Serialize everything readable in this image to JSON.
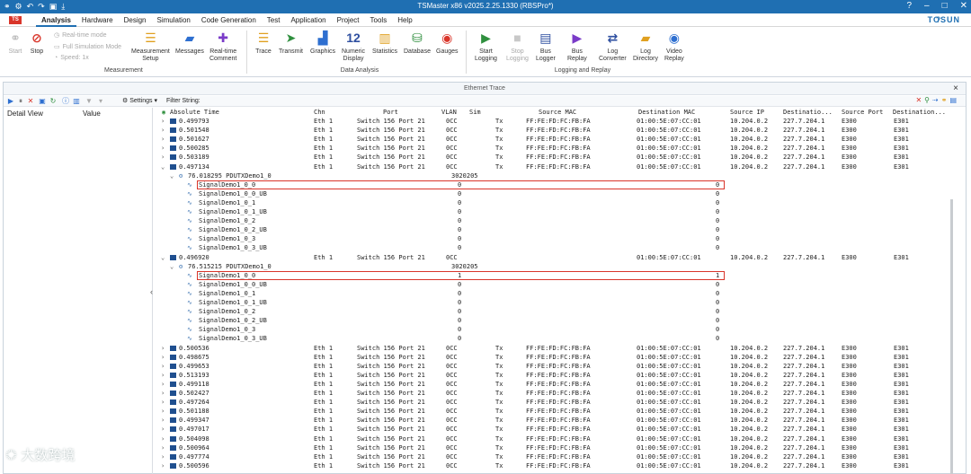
{
  "window": {
    "title": "TSMaster x86 v2025.2.25.1330 (RBSPro*)",
    "help": "?",
    "brand": "TOSUN"
  },
  "menus": [
    "Analysis",
    "Hardware",
    "Design",
    "Simulation",
    "Code Generation",
    "Test",
    "Application",
    "Project",
    "Tools",
    "Help"
  ],
  "ribbon": {
    "start": "Start",
    "stop": "Stop",
    "realtime": "Real-time mode",
    "fullsim": "Full Simulation Mode",
    "speed": "Speed: 1x",
    "measurement_setup": "Measurement\nSetup",
    "messages": "Messages",
    "realtime_comment": "Real-time\nComment",
    "group_measurement": "Measurement",
    "trace": "Trace",
    "transmit": "Transmit",
    "graphics": "Graphics",
    "numeric_display": "Numeric\nDisplay",
    "statistics": "Statistics",
    "database": "Database",
    "gauges": "Gauges",
    "group_data_analysis": "Data Analysis",
    "start_logging": "Start\nLogging",
    "stop_logging": "Stop\nLogging",
    "bus_logger": "Bus\nLogger",
    "bus_replay": "Bus\nReplay",
    "log_converter": "Log\nConverter",
    "log_directory": "Log\nDirectory",
    "video_replay": "Video\nReplay",
    "group_logging": "Logging and Replay",
    "numeric_glyph": "12"
  },
  "panel": {
    "title": "Ethernet Trace",
    "settings": "Settings",
    "filter": "Filter String:",
    "detail_view": "Detail View",
    "value": "Value"
  },
  "columns": [
    "Absolute Time",
    "Chn",
    "Port",
    "VLAN",
    "Sim",
    "Source MAC",
    "Destination MAC",
    "Source IP",
    "Destinatio...",
    "Source Port",
    "Destination..."
  ],
  "rows": [
    {
      "kind": "frame",
      "time": "0.499793",
      "chn": "Eth 1",
      "port": "Switch 156 Port 21",
      "vlan": "0CC",
      "dir": "Tx",
      "smac": "FF:FE:FD:FC:FB:FA",
      "dmac": "01:00:5E:07:CC:01",
      "sip": "10.204.0.2",
      "dip": "227.7.204.1",
      "sport": "E300",
      "dport": "E301"
    },
    {
      "kind": "frame",
      "time": "0.501548",
      "chn": "Eth 1",
      "port": "Switch 156 Port 21",
      "vlan": "0CC",
      "dir": "Tx",
      "smac": "FF:FE:FD:FC:FB:FA",
      "dmac": "01:00:5E:07:CC:01",
      "sip": "10.204.0.2",
      "dip": "227.7.204.1",
      "sport": "E300",
      "dport": "E301"
    },
    {
      "kind": "frame",
      "time": "0.501627",
      "chn": "Eth 1",
      "port": "Switch 156 Port 21",
      "vlan": "0CC",
      "dir": "Tx",
      "smac": "FF:FE:FD:FC:FB:FA",
      "dmac": "01:00:5E:07:CC:01",
      "sip": "10.204.0.2",
      "dip": "227.7.204.1",
      "sport": "E300",
      "dport": "E301"
    },
    {
      "kind": "frame",
      "time": "0.500285",
      "chn": "Eth 1",
      "port": "Switch 156 Port 21",
      "vlan": "0CC",
      "dir": "Tx",
      "smac": "FF:FE:FD:FC:FB:FA",
      "dmac": "01:00:5E:07:CC:01",
      "sip": "10.204.0.2",
      "dip": "227.7.204.1",
      "sport": "E300",
      "dport": "E301"
    },
    {
      "kind": "frame",
      "time": "0.503189",
      "chn": "Eth 1",
      "port": "Switch 156 Port 21",
      "vlan": "0CC",
      "dir": "Tx",
      "smac": "FF:FE:FD:FC:FB:FA",
      "dmac": "01:00:5E:07:CC:01",
      "sip": "10.204.0.2",
      "dip": "227.7.204.1",
      "sport": "E300",
      "dport": "E301"
    },
    {
      "kind": "frame",
      "expanded": true,
      "time": "0.497134",
      "chn": "Eth 1",
      "port": "Switch 156 Port 21",
      "vlan": "0CC",
      "dir": "Tx",
      "smac": "FF:FE:FD:FC:FB:FA",
      "dmac": "01:00:5E:07:CC:01",
      "sip": "10.204.0.2",
      "dip": "227.7.204.1",
      "sport": "E300",
      "dport": "E301"
    },
    {
      "kind": "pdu",
      "name": "76.018295 PDUTXDemo1_0",
      "value": "3020205"
    },
    {
      "kind": "signal",
      "name": "SignalDemo1_0_0",
      "raw": "0",
      "phys": "0",
      "highlight": true
    },
    {
      "kind": "signal",
      "name": "SignalDemo1_0_0_UB",
      "raw": "0",
      "phys": "0"
    },
    {
      "kind": "signal",
      "name": "SignalDemo1_0_1",
      "raw": "0",
      "phys": "0"
    },
    {
      "kind": "signal",
      "name": "SignalDemo1_0_1_UB",
      "raw": "0",
      "phys": "0"
    },
    {
      "kind": "signal",
      "name": "SignalDemo1_0_2",
      "raw": "0",
      "phys": "0"
    },
    {
      "kind": "signal",
      "name": "SignalDemo1_0_2_UB",
      "raw": "0",
      "phys": "0"
    },
    {
      "kind": "signal",
      "name": "SignalDemo1_0_3",
      "raw": "0",
      "phys": "0"
    },
    {
      "kind": "signal",
      "name": "SignalDemo1_0_3_UB",
      "raw": "0",
      "phys": "0"
    },
    {
      "kind": "frame",
      "expanded": true,
      "time": "0.496920",
      "chn": "Eth 1",
      "port": "Switch 156 Port 21",
      "vlan": "0CC",
      "dir": "",
      "smac": "",
      "dmac": "01:00:5E:07:CC:01",
      "sip": "10.204.0.2",
      "dip": "227.7.204.1",
      "sport": "E300",
      "dport": "E301"
    },
    {
      "kind": "pdu",
      "name": "76.515215 PDUTXDemo1_0",
      "value": "3020205"
    },
    {
      "kind": "signal",
      "name": "SignalDemo1_0_0",
      "raw": "1",
      "phys": "1",
      "highlight": true
    },
    {
      "kind": "signal",
      "name": "SignalDemo1_0_0_UB",
      "raw": "0",
      "phys": "0"
    },
    {
      "kind": "signal",
      "name": "SignalDemo1_0_1",
      "raw": "0",
      "phys": "0"
    },
    {
      "kind": "signal",
      "name": "SignalDemo1_0_1_UB",
      "raw": "0",
      "phys": "0"
    },
    {
      "kind": "signal",
      "name": "SignalDemo1_0_2",
      "raw": "0",
      "phys": "0"
    },
    {
      "kind": "signal",
      "name": "SignalDemo1_0_2_UB",
      "raw": "0",
      "phys": "0"
    },
    {
      "kind": "signal",
      "name": "SignalDemo1_0_3",
      "raw": "0",
      "phys": "0"
    },
    {
      "kind": "signal",
      "name": "SignalDemo1_0_3_UB",
      "raw": "0",
      "phys": "0"
    },
    {
      "kind": "frame",
      "time": "0.500536",
      "chn": "Eth 1",
      "port": "Switch 156 Port 21",
      "vlan": "0CC",
      "dir": "Tx",
      "smac": "FF:FE:FD:FC:FB:FA",
      "dmac": "01:00:5E:07:CC:01",
      "sip": "10.204.0.2",
      "dip": "227.7.204.1",
      "sport": "E300",
      "dport": "E301"
    },
    {
      "kind": "frame",
      "time": "0.498675",
      "chn": "Eth 1",
      "port": "Switch 156 Port 21",
      "vlan": "0CC",
      "dir": "Tx",
      "smac": "FF:FE:FD:FC:FB:FA",
      "dmac": "01:00:5E:07:CC:01",
      "sip": "10.204.0.2",
      "dip": "227.7.204.1",
      "sport": "E300",
      "dport": "E301"
    },
    {
      "kind": "frame",
      "time": "0.499653",
      "chn": "Eth 1",
      "port": "Switch 156 Port 21",
      "vlan": "0CC",
      "dir": "Tx",
      "smac": "FF:FE:FD:FC:FB:FA",
      "dmac": "01:00:5E:07:CC:01",
      "sip": "10.204.0.2",
      "dip": "227.7.204.1",
      "sport": "E300",
      "dport": "E301"
    },
    {
      "kind": "frame",
      "time": "0.513193",
      "chn": "Eth 1",
      "port": "Switch 156 Port 21",
      "vlan": "0CC",
      "dir": "Tx",
      "smac": "FF:FE:FD:FC:FB:FA",
      "dmac": "01:00:5E:07:CC:01",
      "sip": "10.204.0.2",
      "dip": "227.7.204.1",
      "sport": "E300",
      "dport": "E301"
    },
    {
      "kind": "frame",
      "time": "0.499118",
      "chn": "Eth 1",
      "port": "Switch 156 Port 21",
      "vlan": "0CC",
      "dir": "Tx",
      "smac": "FF:FE:FD:FC:FB:FA",
      "dmac": "01:00:5E:07:CC:01",
      "sip": "10.204.0.2",
      "dip": "227.7.204.1",
      "sport": "E300",
      "dport": "E301"
    },
    {
      "kind": "frame",
      "time": "0.502427",
      "chn": "Eth 1",
      "port": "Switch 156 Port 21",
      "vlan": "0CC",
      "dir": "Tx",
      "smac": "FF:FE:FD:FC:FB:FA",
      "dmac": "01:00:5E:07:CC:01",
      "sip": "10.204.0.2",
      "dip": "227.7.204.1",
      "sport": "E300",
      "dport": "E301"
    },
    {
      "kind": "frame",
      "time": "0.497264",
      "chn": "Eth 1",
      "port": "Switch 156 Port 21",
      "vlan": "0CC",
      "dir": "Tx",
      "smac": "FF:FE:FD:FC:FB:FA",
      "dmac": "01:00:5E:07:CC:01",
      "sip": "10.204.0.2",
      "dip": "227.7.204.1",
      "sport": "E300",
      "dport": "E301"
    },
    {
      "kind": "frame",
      "time": "0.501188",
      "chn": "Eth 1",
      "port": "Switch 156 Port 21",
      "vlan": "0CC",
      "dir": "Tx",
      "smac": "FF:FE:FD:FC:FB:FA",
      "dmac": "01:00:5E:07:CC:01",
      "sip": "10.204.0.2",
      "dip": "227.7.204.1",
      "sport": "E300",
      "dport": "E301"
    },
    {
      "kind": "frame",
      "time": "0.499347",
      "chn": "Eth 1",
      "port": "Switch 156 Port 21",
      "vlan": "0CC",
      "dir": "Tx",
      "smac": "FF:FE:FD:FC:FB:FA",
      "dmac": "01:00:5E:07:CC:01",
      "sip": "10.204.0.2",
      "dip": "227.7.204.1",
      "sport": "E300",
      "dport": "E301"
    },
    {
      "kind": "frame",
      "time": "0.497017",
      "chn": "Eth 1",
      "port": "Switch 156 Port 21",
      "vlan": "0CC",
      "dir": "Tx",
      "smac": "FF:FE:FD:FC:FB:FA",
      "dmac": "01:00:5E:07:CC:01",
      "sip": "10.204.0.2",
      "dip": "227.7.204.1",
      "sport": "E300",
      "dport": "E301"
    },
    {
      "kind": "frame",
      "time": "0.504098",
      "chn": "Eth 1",
      "port": "Switch 156 Port 21",
      "vlan": "0CC",
      "dir": "Tx",
      "smac": "FF:FE:FD:FC:FB:FA",
      "dmac": "01:00:5E:07:CC:01",
      "sip": "10.204.0.2",
      "dip": "227.7.204.1",
      "sport": "E300",
      "dport": "E301"
    },
    {
      "kind": "frame",
      "time": "0.500964",
      "chn": "Eth 1",
      "port": "Switch 156 Port 21",
      "vlan": "0CC",
      "dir": "Tx",
      "smac": "FF:FE:FD:FC:FB:FA",
      "dmac": "01:00:5E:07:CC:01",
      "sip": "10.204.0.2",
      "dip": "227.7.204.1",
      "sport": "E300",
      "dport": "E301"
    },
    {
      "kind": "frame",
      "time": "0.497774",
      "chn": "Eth 1",
      "port": "Switch 156 Port 21",
      "vlan": "0CC",
      "dir": "Tx",
      "smac": "FF:FE:FD:FC:FB:FA",
      "dmac": "01:00:5E:07:CC:01",
      "sip": "10.204.0.2",
      "dip": "227.7.204.1",
      "sport": "E300",
      "dport": "E301"
    },
    {
      "kind": "frame",
      "time": "0.500596",
      "chn": "Eth 1",
      "port": "Switch 156 Port 21",
      "vlan": "0CC",
      "dir": "Tx",
      "smac": "FF:FE:FD:FC:FB:FA",
      "dmac": "01:00:5E:07:CC:01",
      "sip": "10.204.0.2",
      "dip": "227.7.204.1",
      "sport": "E300",
      "dport": "E301"
    }
  ],
  "watermark": "大数跨境",
  "colors": {
    "accent": "#1f6fb2",
    "highlight_box": "#d9352a",
    "frame_icon": "#1f4f8f"
  }
}
